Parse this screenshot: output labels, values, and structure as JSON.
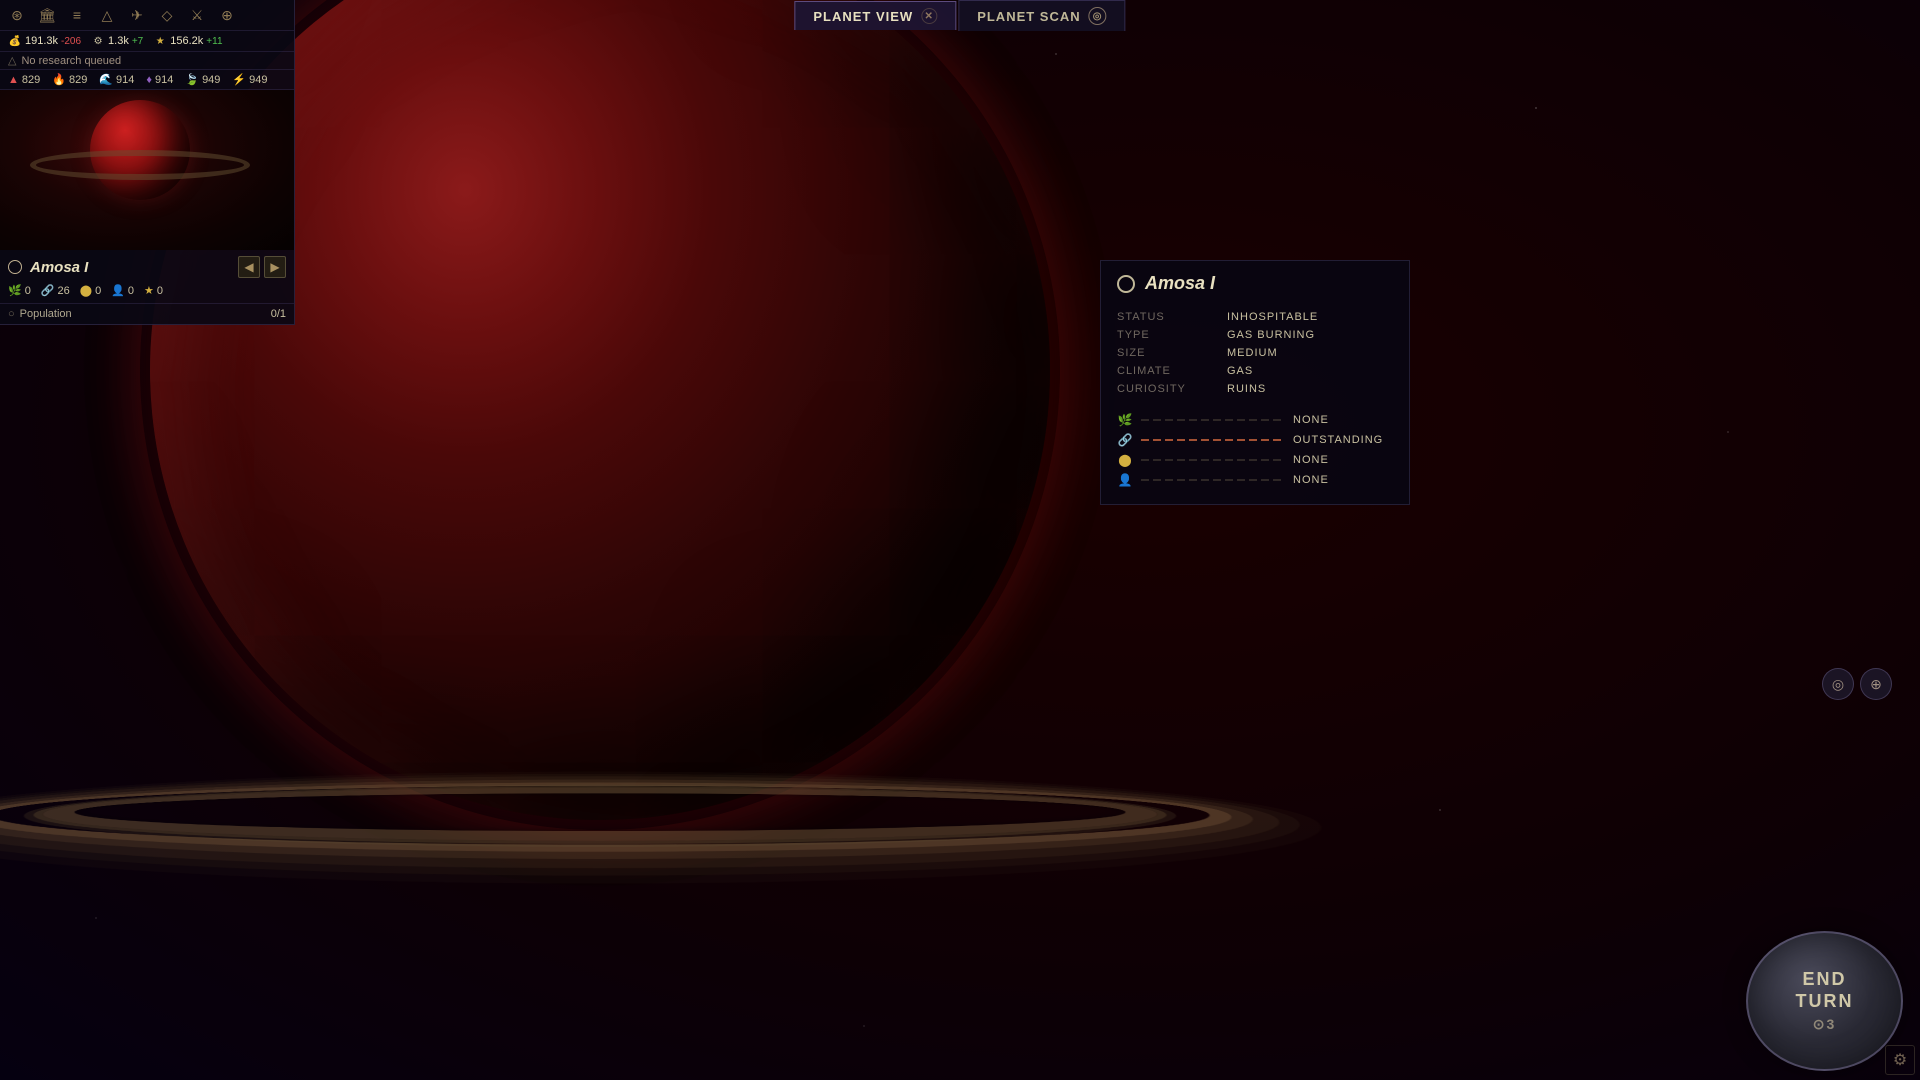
{
  "toolbar": {
    "icons": [
      "⚙",
      "🏛",
      "📋",
      "⚗",
      "✈",
      "🏆",
      "⚔",
      "⊕"
    ]
  },
  "resources": {
    "credits": {
      "value": "191.3k",
      "delta": "-206",
      "icon": "💰"
    },
    "industry": {
      "value": "1.3k",
      "delta": "+7",
      "icon": "⚙"
    },
    "science": {
      "value": "156.2k",
      "delta": "+11",
      "icon": "⭐"
    },
    "research_notice": "No research queued"
  },
  "stats": [
    {
      "icon": "🔺",
      "color": "red",
      "value": "829"
    },
    {
      "icon": "🔥",
      "color": "orange",
      "value": "829"
    },
    {
      "icon": "💧",
      "color": "orange",
      "value": "914"
    },
    {
      "icon": "💜",
      "color": "purple",
      "value": "914"
    },
    {
      "icon": "🌿",
      "color": "green",
      "value": "949"
    },
    {
      "icon": "⚡",
      "color": "yellow",
      "value": "949"
    }
  ],
  "planet_panel": {
    "name": "Amosa I",
    "orbit_icon": "○",
    "stats": [
      {
        "icon": "🌿",
        "value": "0"
      },
      {
        "icon": "🔗",
        "value": "26"
      },
      {
        "icon": "🟡",
        "value": "0"
      },
      {
        "icon": "👥",
        "value": "0"
      },
      {
        "icon": "⭐",
        "value": "0"
      }
    ],
    "population": {
      "label": "Population",
      "value": "0/1"
    }
  },
  "tabs": [
    {
      "label": "PLANET VIEW",
      "active": true,
      "closeable": true
    },
    {
      "label": "PLANET SCAN",
      "active": false,
      "closeable": false,
      "icon": "scan"
    }
  ],
  "detail_panel": {
    "planet_name": "Amosa I",
    "status_label": "STATUS",
    "status_value": "INHOSPITABLE",
    "type_label": "TYPE",
    "type_value": "GAS BURNING",
    "size_label": "SIZE",
    "size_value": "MEDIUM",
    "climate_label": "CLIMATE",
    "climate_value": "GAS",
    "curiosity_label": "CURIOSITY",
    "curiosity_value": "RUINS",
    "resources": [
      {
        "icon": "🌿",
        "color": "green",
        "level": "none",
        "label": "NONE"
      },
      {
        "icon": "🔗",
        "color": "orange",
        "level": "outstanding",
        "label": "OUTSTANDING"
      },
      {
        "icon": "🟡",
        "color": "yellow",
        "level": "none",
        "label": "NONE"
      },
      {
        "icon": "👥",
        "color": "cyan",
        "level": "none",
        "label": "NONE"
      }
    ]
  },
  "end_turn": {
    "line1": "END",
    "line2": "TURN",
    "number": "⊙3"
  },
  "nav_arrows": {
    "left": "◀",
    "right": "▶",
    "top": "▲"
  }
}
